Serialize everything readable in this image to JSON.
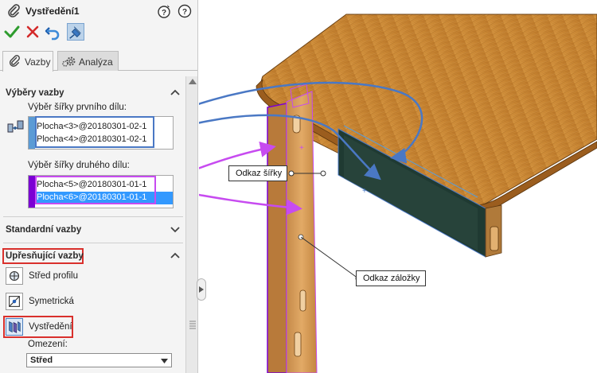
{
  "feature": {
    "title": "Vystředění1"
  },
  "commands": {
    "ok": "check-icon",
    "cancel": "close-icon",
    "undo": "undo-icon",
    "pin": "pushpin-icon"
  },
  "tabs": [
    {
      "label": "Vazby",
      "icon": "paperclip-icon",
      "active": true
    },
    {
      "label": "Analýza",
      "icon": "gears-icon",
      "active": false
    }
  ],
  "selections": {
    "heading": "Výběry vazby",
    "first": {
      "label": "Výběr šířky prvního dílu:",
      "items": [
        "Plocha<3>@20180301-02-1",
        "Plocha<4>@20180301-02-1"
      ],
      "color": "#5b9bd5"
    },
    "second": {
      "label": "Výběr šířky druhého dílu:",
      "items": [
        "Plocha<5>@20180301-01-1",
        "Plocha<6>@20180301-01-1"
      ],
      "color": "#7b00d4"
    }
  },
  "standard": {
    "heading": "Standardní vazby"
  },
  "advanced": {
    "heading": "Upřesňující vazby",
    "options": [
      {
        "label": "Střed profilu",
        "icon": "profile-center-icon"
      },
      {
        "label": "Symetrická",
        "icon": "symmetric-icon"
      },
      {
        "label": "Vystředění",
        "icon": "width-mate-icon",
        "selected": true
      }
    ],
    "constraint_label": "Omezení:",
    "constraint_value": "Střed"
  },
  "callouts": {
    "width_ref": "Odkaz šířky",
    "tab_ref": "Odkaz záložky"
  },
  "colors": {
    "highlight_red": "#d9302c",
    "selection_blue": "#3399ff",
    "arrow_blue": "#4a78c4",
    "arrow_purple": "#c74bf0",
    "wood": "#c98a3a"
  }
}
